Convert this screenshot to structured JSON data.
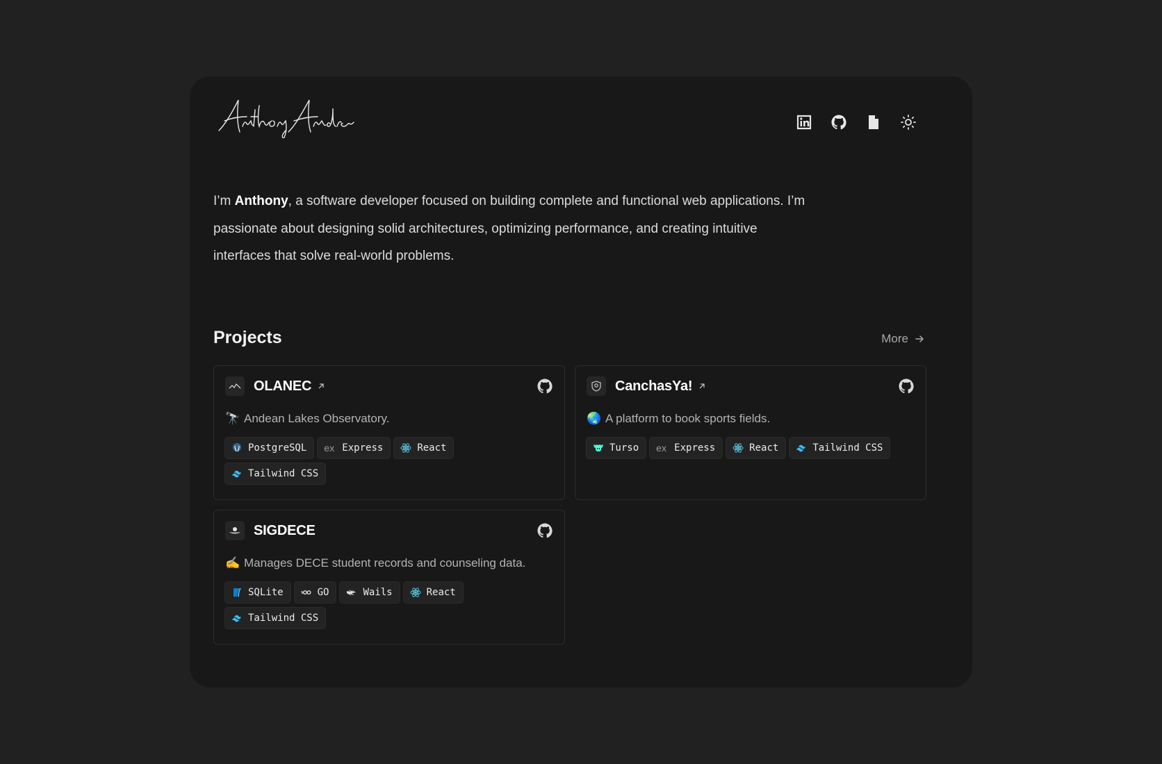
{
  "header": {
    "icons": [
      "linkedin-icon",
      "github-icon",
      "document-icon",
      "sun-icon"
    ]
  },
  "intro": {
    "prefix": "I’m ",
    "name": "Anthony",
    "rest": ", a software developer focused on building complete and functional web applications. I’m passionate about designing solid architectures, optimizing performance, and creating intuitive interfaces that solve real-world problems."
  },
  "projects": {
    "title": "Projects",
    "more_label": "More",
    "items": [
      {
        "name": "OLANEC",
        "emoji": "🔭",
        "description": "Andean Lakes Observatory.",
        "tags": [
          "PostgreSQL",
          "Express",
          "React",
          "Tailwind CSS"
        ]
      },
      {
        "name": "CanchasYa!",
        "emoji": "🌏",
        "description": "A platform to book sports fields.",
        "tags": [
          "Turso",
          "Express",
          "React",
          "Tailwind CSS"
        ]
      },
      {
        "name": "SIGDECE",
        "emoji": "✍️",
        "description": "Manages DECE student records and counseling data.",
        "tags": [
          "SQLite",
          "GO",
          "Wails",
          "React",
          "Tailwind CSS"
        ]
      }
    ]
  },
  "colors": {
    "page_bg": "#212121",
    "card_bg": "#181818",
    "react": "#58c4dc",
    "tailwind": "#38bdf8",
    "turso": "#4ff8d2",
    "postgres": "#336791",
    "sqlite": "#0f80cc"
  }
}
